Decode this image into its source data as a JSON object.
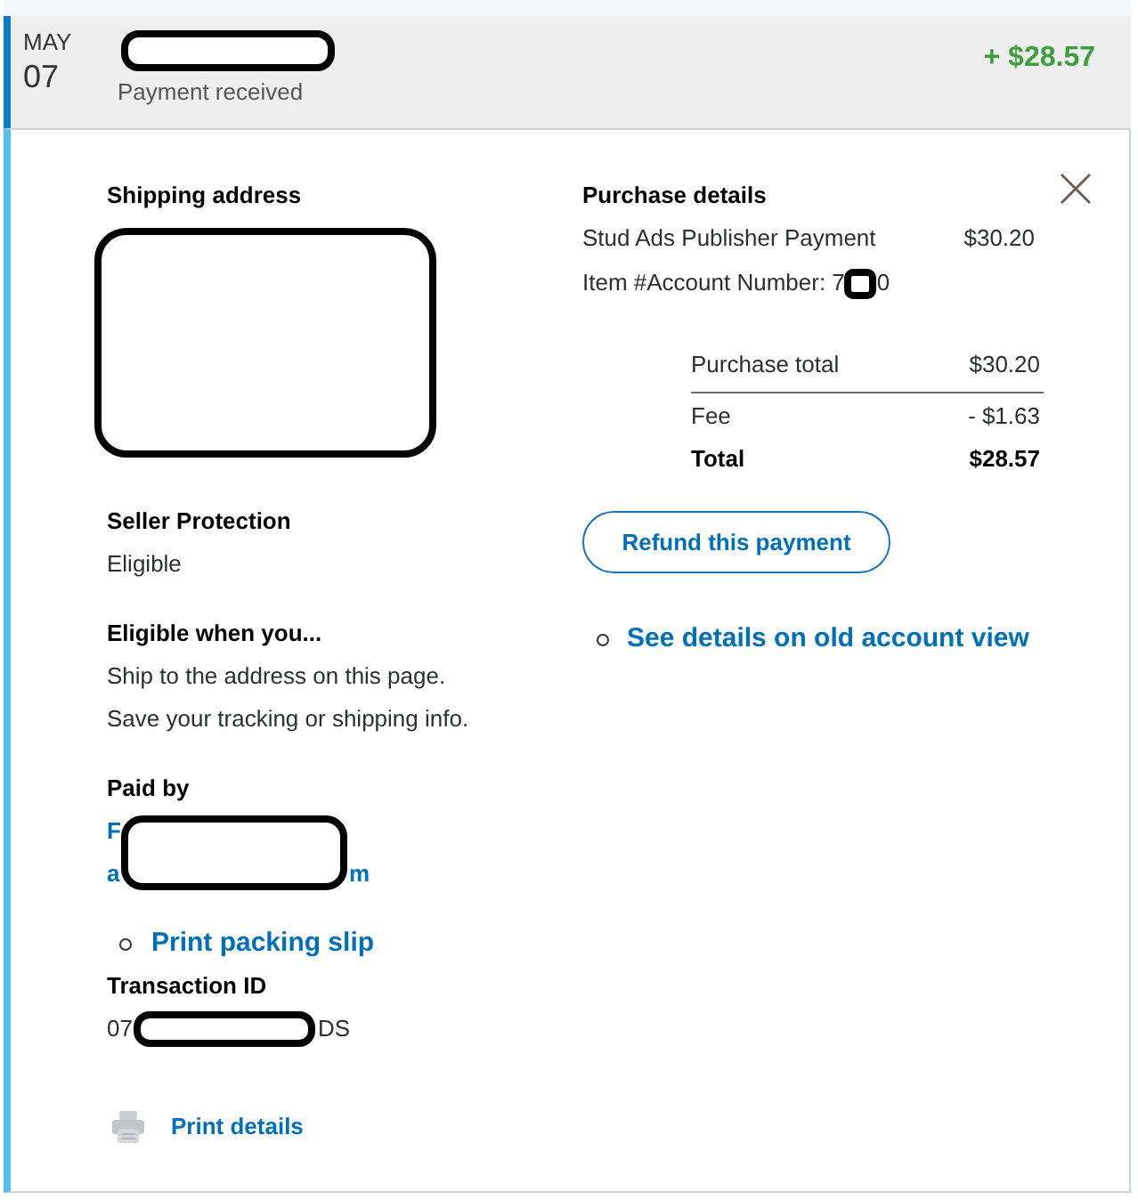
{
  "transaction": {
    "month": "MAY",
    "day": "07",
    "counterparty": [
      {
        "kind": "redaction"
      }
    ],
    "status": "Payment received",
    "amount": "+ $28.57"
  },
  "shipping": {
    "heading": "Shipping address",
    "address": [
      {
        "kind": "redaction"
      }
    ]
  },
  "seller_protection": {
    "heading": "Seller Protection",
    "status": "Eligible"
  },
  "eligibility": {
    "heading": "Eligible when you...",
    "conditions": [
      "Ship to the address on this page.",
      "Save your tracking or shipping info."
    ]
  },
  "paid_by": {
    "heading": "Paid by",
    "line_1_start": "F",
    "line_2_start": "a",
    "line_2_end": "m",
    "redacted": true
  },
  "packing_slip_link": "Print packing slip",
  "transaction_id": {
    "heading": "Transaction ID",
    "value": [
      {
        "kind": "text",
        "text": "07"
      },
      {
        "kind": "redaction"
      },
      {
        "kind": "text",
        "text": "DS"
      }
    ]
  },
  "print_details_link": "Print details",
  "purchase": {
    "heading": "Purchase details",
    "item_name": "Stud Ads Publisher Payment",
    "item_price": "$30.20",
    "item_number": [
      {
        "kind": "text",
        "text": "Item #Account Number: 7"
      },
      {
        "kind": "redaction"
      },
      {
        "kind": "text",
        "text": "0"
      }
    ]
  },
  "summary": [
    {
      "kind": "subtotal",
      "label": "Purchase total",
      "value": "$30.20"
    },
    {
      "kind": "fee",
      "label": "Fee",
      "value": "- $1.63"
    },
    {
      "kind": "total",
      "label": "Total",
      "value": "$28.57"
    }
  ],
  "refund_button": "Refund this payment",
  "old_view_link": "See details on old account view"
}
